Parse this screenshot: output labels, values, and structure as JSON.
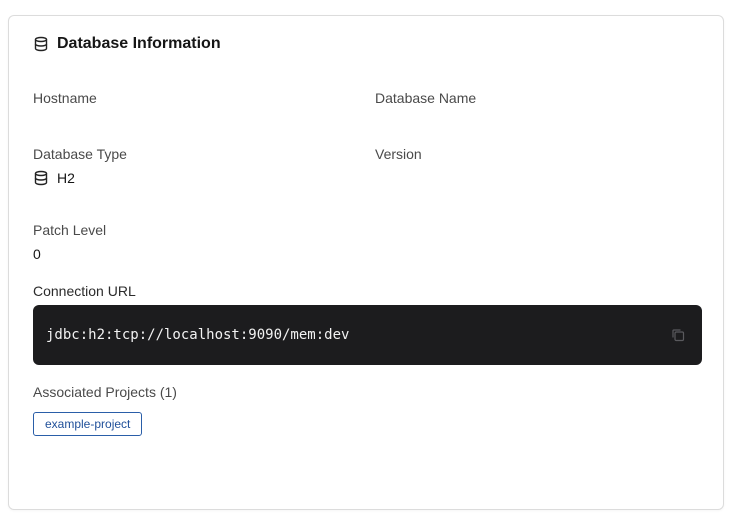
{
  "panel": {
    "title": "Database Information",
    "title_icon": "database-icon"
  },
  "fields": {
    "hostname_label": "Hostname",
    "hostname_value": "",
    "database_name_label": "Database Name",
    "database_name_value": "",
    "database_type_label": "Database Type",
    "database_type_value": "H2",
    "database_type_icon": "database-icon",
    "version_label": "Version",
    "version_value": "",
    "patch_level_label": "Patch Level",
    "patch_level_value": "0"
  },
  "connection": {
    "label": "Connection URL",
    "url": "jdbc:h2:tcp://localhost:9090/mem:dev",
    "copy_icon": "copy-icon"
  },
  "projects": {
    "label": "Associated Projects (1)",
    "items": [
      "example-project"
    ]
  },
  "colors": {
    "url_background": "#1c1c1e",
    "chip_border": "#2a5ea8",
    "chip_text": "#1f4f99"
  }
}
